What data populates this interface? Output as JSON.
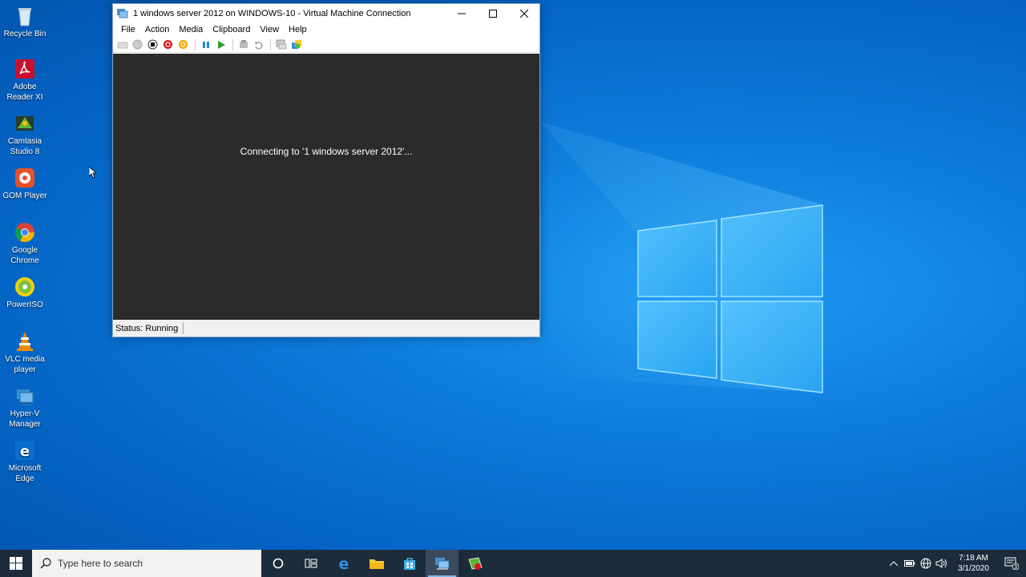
{
  "desktop": {
    "icons": [
      {
        "label1": "Recycle Bin",
        "label2": ""
      },
      {
        "label1": "Adobe",
        "label2": "Reader XI"
      },
      {
        "label1": "Camtasia",
        "label2": "Studio 8"
      },
      {
        "label1": "GOM Player",
        "label2": ""
      },
      {
        "label1": "Google",
        "label2": "Chrome"
      },
      {
        "label1": "PowerISO",
        "label2": ""
      },
      {
        "label1": "VLC media",
        "label2": "player"
      },
      {
        "label1": "Hyper-V",
        "label2": "Manager"
      },
      {
        "label1": "Microsoft",
        "label2": "Edge"
      }
    ]
  },
  "vm_window": {
    "title": "1 windows server 2012 on WINDOWS-10 - Virtual Machine Connection",
    "menu": [
      "File",
      "Action",
      "Media",
      "Clipboard",
      "View",
      "Help"
    ],
    "screen_message": "Connecting to '1 windows server 2012'...",
    "status": "Status: Running"
  },
  "taskbar": {
    "search_placeholder": "Type here to search",
    "time": "7:18 AM",
    "date": "3/1/2020",
    "notification_count": "3"
  },
  "colors": {
    "accent": "#0078d7",
    "taskbar_bg": "#1d2c3b",
    "vm_screen_bg": "#2b2b2b"
  }
}
